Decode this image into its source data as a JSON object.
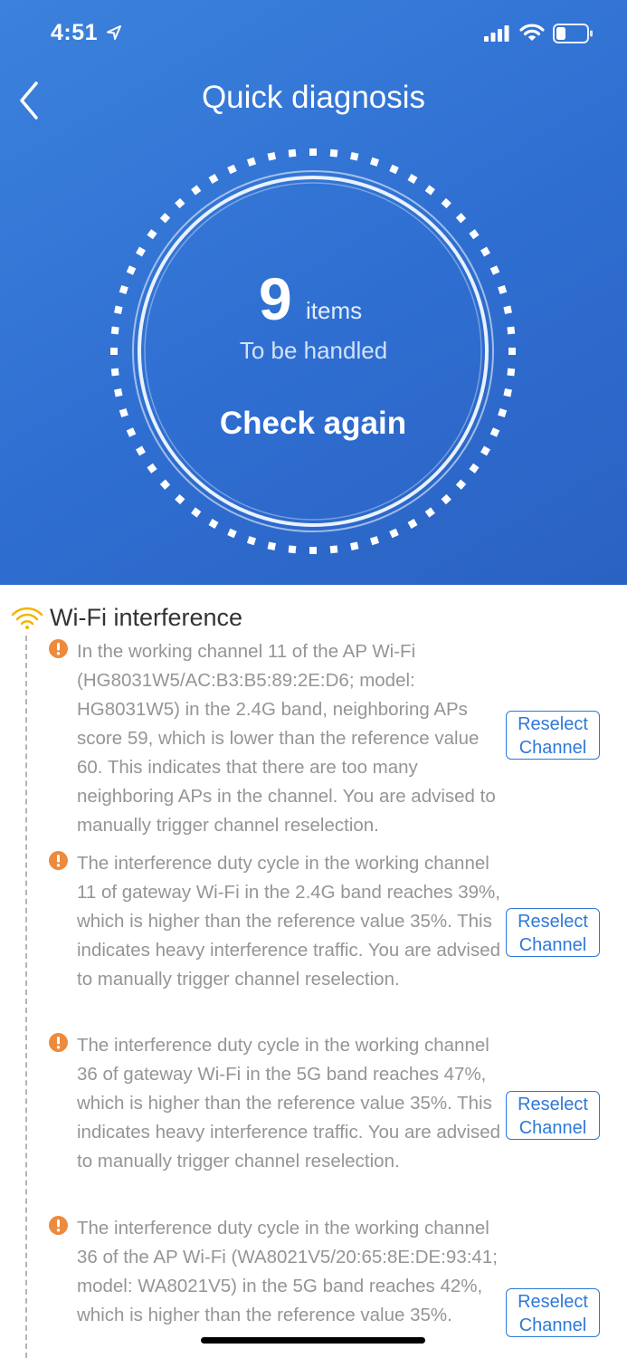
{
  "status_bar": {
    "time": "4:51",
    "icons": [
      "location-arrow-icon",
      "signal-icon",
      "wifi-icon",
      "battery-icon"
    ]
  },
  "header": {
    "back_icon": "chevron-left-icon",
    "title": "Quick diagnosis"
  },
  "summary": {
    "count": "9",
    "unit": "items",
    "caption": "To be handled",
    "action_label": "Check again"
  },
  "section": {
    "icon": "wifi-icon",
    "title": "Wi-Fi interference",
    "issues": [
      {
        "text": "In the working channel 11 of the AP Wi-Fi (HG8031W5/AC:B3:B5:89:2E:D6; model: HG8031W5) in the 2.4G band, neighboring APs score 59, which is lower than the reference value 60. This indicates that there are too many neighboring APs in the channel. You are advised to manually trigger channel reselection.",
        "button_line1": "Reselect",
        "button_line2": "Channel"
      },
      {
        "text": "The interference duty cycle in the working channel 11 of gateway Wi-Fi in the 2.4G band reaches 39%, which is higher than the reference value 35%. This indicates heavy interference traffic. You are advised to manually trigger channel reselection.",
        "button_line1": "Reselect",
        "button_line2": "Channel"
      },
      {
        "text": "The interference duty cycle in the working channel 36 of gateway Wi-Fi in the 5G band reaches 47%, which is higher than the reference value 35%. This indicates heavy interference traffic. You are advised to manually trigger channel reselection.",
        "button_line1": "Reselect",
        "button_line2": "Channel"
      },
      {
        "text": "The interference duty cycle in the working channel 36 of the AP Wi-Fi (WA8021V5/20:65:8E:DE:93:41; model: WA8021V5) in the 5G band reaches 42%, which is higher than the reference value 35%.",
        "button_line1": "Reselect",
        "button_line2": "Channel"
      }
    ]
  },
  "colors": {
    "header_blue": "#2f6ed1",
    "accent_blue": "#2f78d9",
    "warning_orange": "#ec8a3d",
    "wifi_yellow": "#f4b400",
    "body_text_gray": "#959595"
  }
}
